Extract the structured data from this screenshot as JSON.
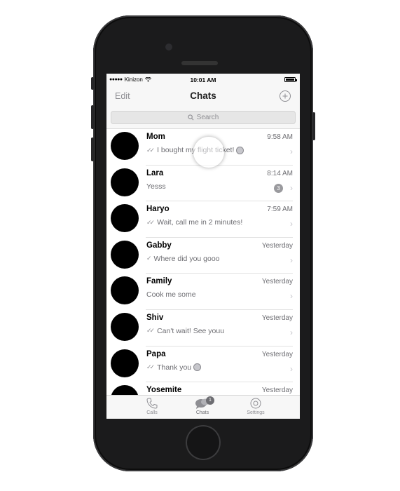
{
  "status_bar": {
    "carrier": "Kinizon",
    "time": "10:01 AM"
  },
  "nav": {
    "edit_label": "Edit",
    "title": "Chats"
  },
  "search": {
    "placeholder": "Search"
  },
  "chats": [
    {
      "name": "Mom",
      "time": "9:58 AM",
      "message": "I bought my flight ticket!",
      "status": "read"
    },
    {
      "name": "Lara",
      "time": "8:14 AM",
      "message": "Yesss",
      "unread": "3"
    },
    {
      "name": "Haryo",
      "time": "7:59 AM",
      "message": "Wait, call me in 2 minutes!",
      "status": "read"
    },
    {
      "name": "Gabby",
      "time": "Yesterday",
      "message": "Where did you gooo",
      "status": "sent"
    },
    {
      "name": "Family",
      "time": "Yesterday",
      "message": "Cook me some"
    },
    {
      "name": "Shiv",
      "time": "Yesterday",
      "message": "Can't wait! See youu",
      "status": "read"
    },
    {
      "name": "Papa",
      "time": "Yesterday",
      "message": "Thank you",
      "status": "read"
    },
    {
      "name": "Yosemite",
      "time": "Yesterday",
      "message": ""
    }
  ],
  "tabbar": {
    "calls_label": "Calls",
    "chats_label": "Chats",
    "chats_badge": "1",
    "settings_label": "Settings"
  },
  "colors": {
    "bar_background": "#f7f7f7",
    "secondary_text": "#8e8e93",
    "avatar": "#000000"
  }
}
